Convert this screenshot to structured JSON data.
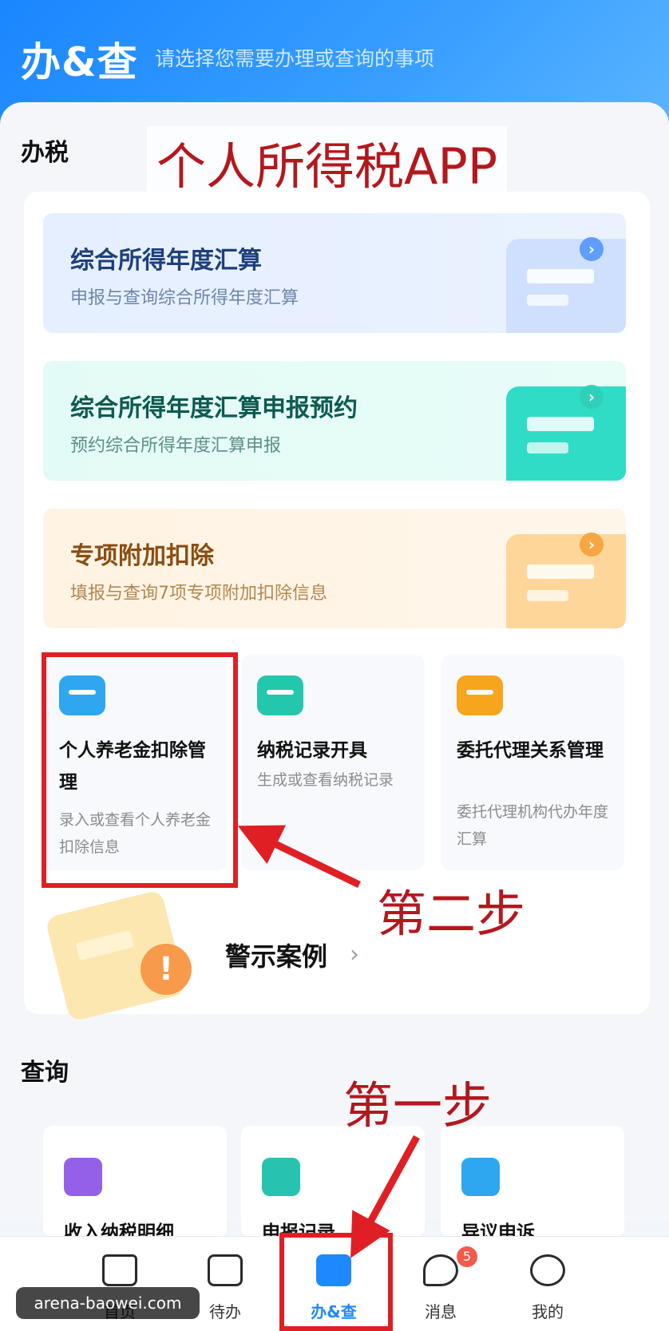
{
  "header": {
    "title": "办&查",
    "subtitle": "请选择您需要办理或查询的事项"
  },
  "annotations": {
    "app_name": "个人所得税APP",
    "step2": "第二步",
    "step1": "第一步"
  },
  "sections": {
    "tax": "办税",
    "query": "查询"
  },
  "banners": [
    {
      "title": "综合所得年度汇算",
      "subtitle": "申报与查询综合所得年度汇算"
    },
    {
      "title": "综合所得年度汇算申报预约",
      "subtitle": "预约综合所得年度汇算申报"
    },
    {
      "title": "专项附加扣除",
      "subtitle": "填报与查询7项专项附加扣除信息"
    }
  ],
  "tiles": [
    {
      "title": "个人养老金扣除管理",
      "subtitle": "录入或查看个人养老金扣除信息",
      "icon": "wallet-icon"
    },
    {
      "title": "纳税记录开具",
      "subtitle": "生成或查看纳税记录",
      "icon": "certificate-icon"
    },
    {
      "title": "委托代理关系管理",
      "subtitle": "委托代理机构代办年度汇算",
      "icon": "agent-icon"
    }
  ],
  "warning": {
    "title": "警示案例",
    "chevron": "›"
  },
  "query_tiles": [
    {
      "title": "收入纳税明细",
      "icon": "income-icon"
    },
    {
      "title": "申报记录",
      "icon": "record-icon"
    },
    {
      "title": "异议申诉",
      "icon": "appeal-icon"
    }
  ],
  "tabbar": {
    "items": [
      {
        "label": "首页",
        "icon": "home-icon"
      },
      {
        "label": "待办",
        "icon": "calendar-icon"
      },
      {
        "label": "办&查",
        "icon": "card-icon",
        "active": true
      },
      {
        "label": "消息",
        "icon": "message-icon",
        "badge": "5"
      },
      {
        "label": "我的",
        "icon": "smile-icon"
      }
    ]
  },
  "watermark": "arena-baowei.com",
  "colors": {
    "accent": "#1e88ff",
    "annotation_red": "#e01f24",
    "badge": "#f15b4a"
  }
}
